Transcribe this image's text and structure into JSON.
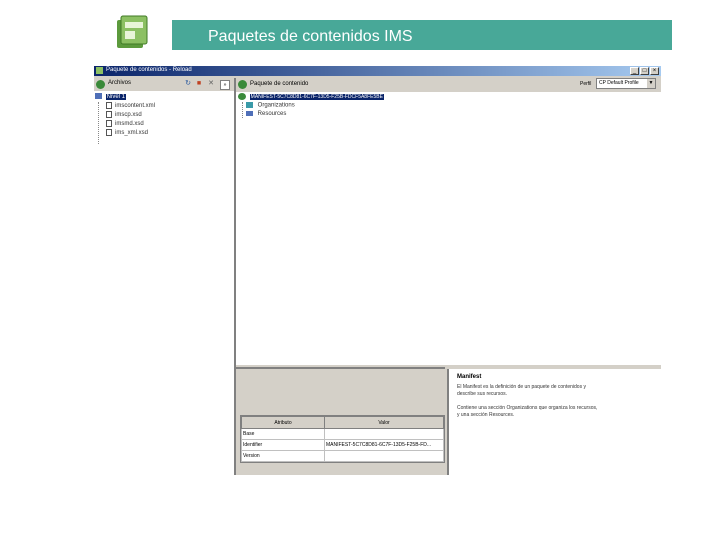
{
  "slide": {
    "title": "Paquetes de contenidos IMS"
  },
  "window": {
    "title": "Paquete de contenidos - Reload",
    "buttons": [
      "_",
      "□",
      "×"
    ]
  },
  "left_pane": {
    "root_label": "Archivos",
    "folder_label": "Nivel 1",
    "files": [
      "imscontent.xml",
      "imscp.xsd",
      "imsmd.xsd",
      "ims_xml.xsd"
    ]
  },
  "right_pane": {
    "header_label": "Paquete de contenido",
    "profile_label": "Perfil",
    "profile_value": "CP Default Profile",
    "manifest_id": "MANIFEST-5C7C8D81-6C7F-13D5-F25B-FDCF5A8FE5BE",
    "children": [
      "Organizations",
      "Resources"
    ]
  },
  "attributes": {
    "columns": [
      "Atributo",
      "Valor"
    ],
    "rows": [
      [
        "Base",
        ""
      ],
      [
        "Identifier",
        "MANIFEST-5C7C8D81-6C7F-13D5-F25B-FD..."
      ],
      [
        "Version",
        ""
      ]
    ]
  },
  "help": {
    "title": "Manifest",
    "lines": [
      "El Manifest es la definición de un paquete de contenidos y",
      "describe sus recursos.",
      "",
      "Contiene una sección Organizations que organiza los recursos,",
      "y una sección Resources."
    ]
  }
}
